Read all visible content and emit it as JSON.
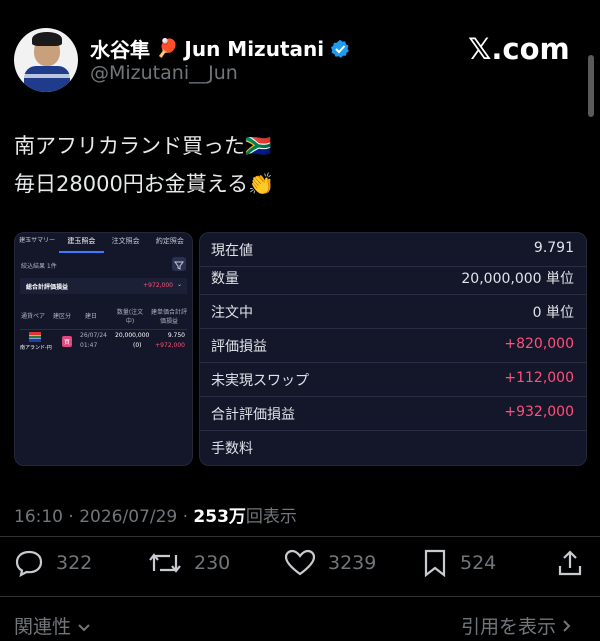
{
  "author": {
    "display_name": "水谷隼",
    "emoji": "🏓",
    "name_en": "Jun Mizutani",
    "handle": "@Mizutani__Jun",
    "verified": true
  },
  "brand": "𝕏.com",
  "tweet": {
    "line1": "南アフリカランド買った",
    "line1_emoji": "🇿🇦",
    "line2": "毎日28000円お金貰える",
    "line2_emoji": "👏"
  },
  "left_card": {
    "tabs": [
      "建玉サマリー",
      "建玉照会",
      "注文照会",
      "約定照会"
    ],
    "filter_label": "絞込結果 1件",
    "total_label": "総合計評価損益",
    "total_value": "+972,000",
    "headers": [
      "通貨ペア",
      "建区分",
      "建日",
      "数量(注文中)",
      "建単価合計評価損益"
    ],
    "pair": "南アランド-円",
    "side": "買",
    "date": "26/07/24",
    "time": "01:47",
    "qty": "20,000,000",
    "qty_pending": "(0)",
    "price": "9.750",
    "pl": "+972,000"
  },
  "right_card": {
    "rows": [
      {
        "label": "現在値",
        "value": "9.791"
      },
      {
        "label": "数量",
        "value": "20,000,000 単位"
      },
      {
        "label": "注文中",
        "value": "0 単位"
      },
      {
        "label": "評価損益",
        "value": "+820,000"
      },
      {
        "label": "未実現スワップ",
        "value": "+112,000"
      },
      {
        "label": "合計評価損益",
        "value": "+932,000"
      },
      {
        "label": "手数料",
        "value": ""
      }
    ]
  },
  "meta": {
    "time": "16:10",
    "date": "2026/07/29",
    "views": "253万",
    "views_label": "回表示"
  },
  "actions": {
    "replies": "322",
    "reposts": "230",
    "likes": "3239",
    "bookmarks": "524"
  },
  "footer": {
    "related": "関連性",
    "quotes": "引用を表示"
  },
  "colors": {
    "background": "#000000",
    "positive": "#ff4f7a",
    "verified": "#1d9bf0",
    "card": "#141729"
  }
}
